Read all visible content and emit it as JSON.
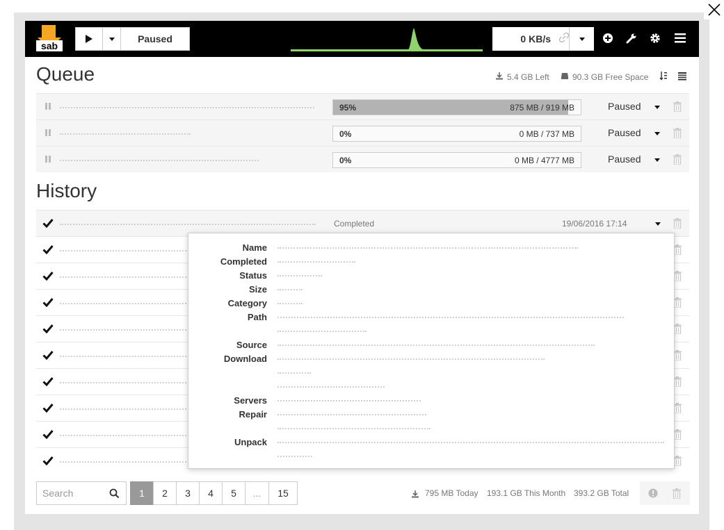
{
  "topbar": {
    "logo_text": "sab",
    "pause_label": "Paused",
    "speed_value": "0 KB/s"
  },
  "queue": {
    "title": "Queue",
    "left_text": "5.4 GB Left",
    "free_space_text": "90.3 GB Free Space",
    "rows": [
      {
        "percent_label": "95%",
        "progress": 0.95,
        "size_text": "875 MB / 919 MB",
        "status": "Paused"
      },
      {
        "percent_label": "0%",
        "progress": 0.0,
        "size_text": "0 MB / 737 MB",
        "status": "Paused"
      },
      {
        "percent_label": "0%",
        "progress": 0.0,
        "size_text": "0 MB / 4777 MB",
        "status": "Paused"
      }
    ]
  },
  "history": {
    "title": "History",
    "rows": [
      {
        "status": "Completed",
        "date": "19/06/2016 17:14"
      },
      {
        "status": "",
        "date": ""
      },
      {
        "status": "",
        "date": ""
      },
      {
        "status": "",
        "date": ""
      },
      {
        "status": "",
        "date": ""
      },
      {
        "status": "",
        "date": ""
      },
      {
        "status": "",
        "date": ""
      },
      {
        "status": "",
        "date": ""
      },
      {
        "status": "",
        "date": ""
      },
      {
        "status": "",
        "date": ""
      }
    ],
    "details_labels": {
      "name": "Name",
      "completed": "Completed",
      "status": "Status",
      "size": "Size",
      "category": "Category",
      "path": "Path",
      "source": "Source",
      "download": "Download",
      "servers": "Servers",
      "repair": "Repair",
      "unpack": "Unpack"
    }
  },
  "footer": {
    "search_placeholder": "Search",
    "pages": [
      "1",
      "2",
      "3",
      "4",
      "5",
      "...",
      "15"
    ],
    "active_page": "1",
    "today_text": "795 MB Today",
    "month_text": "193.1 GB This Month",
    "total_text": "393.2 GB Total"
  },
  "colors": {
    "topbar_bg": "#000000",
    "logo_orange": "#f5a623",
    "graph_green": "#8fd36f",
    "progress_fill": "#b3b3b3",
    "active_page_bg": "#999999"
  },
  "icons": [
    "close-icon",
    "play-icon",
    "chevron-down-icon",
    "link-icon",
    "plus-circle-icon",
    "wrench-icon",
    "gear-icon",
    "menu-icon",
    "download-icon",
    "hard-drive-icon",
    "sort-icon",
    "list-icon",
    "pause-icon",
    "trash-icon",
    "check-icon",
    "search-icon",
    "warning-icon"
  ]
}
